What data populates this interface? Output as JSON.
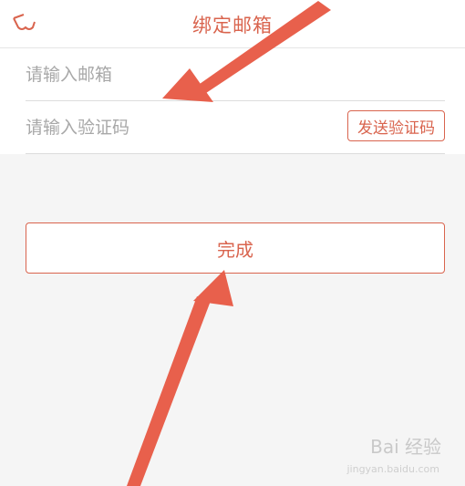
{
  "header": {
    "title": "绑定邮箱",
    "back_icon": "back-icon"
  },
  "form": {
    "email_placeholder": "请输入邮箱",
    "code_placeholder": "请输入验证码",
    "send_code_label": "发送验证码"
  },
  "actions": {
    "done_label": "完成"
  },
  "watermark": {
    "brand": "Bai 经验",
    "url": "jingyan.baidu.com"
  },
  "colors": {
    "accent": "#d9644e",
    "arrow": "#e8604c",
    "background": "#f5f5f5"
  }
}
